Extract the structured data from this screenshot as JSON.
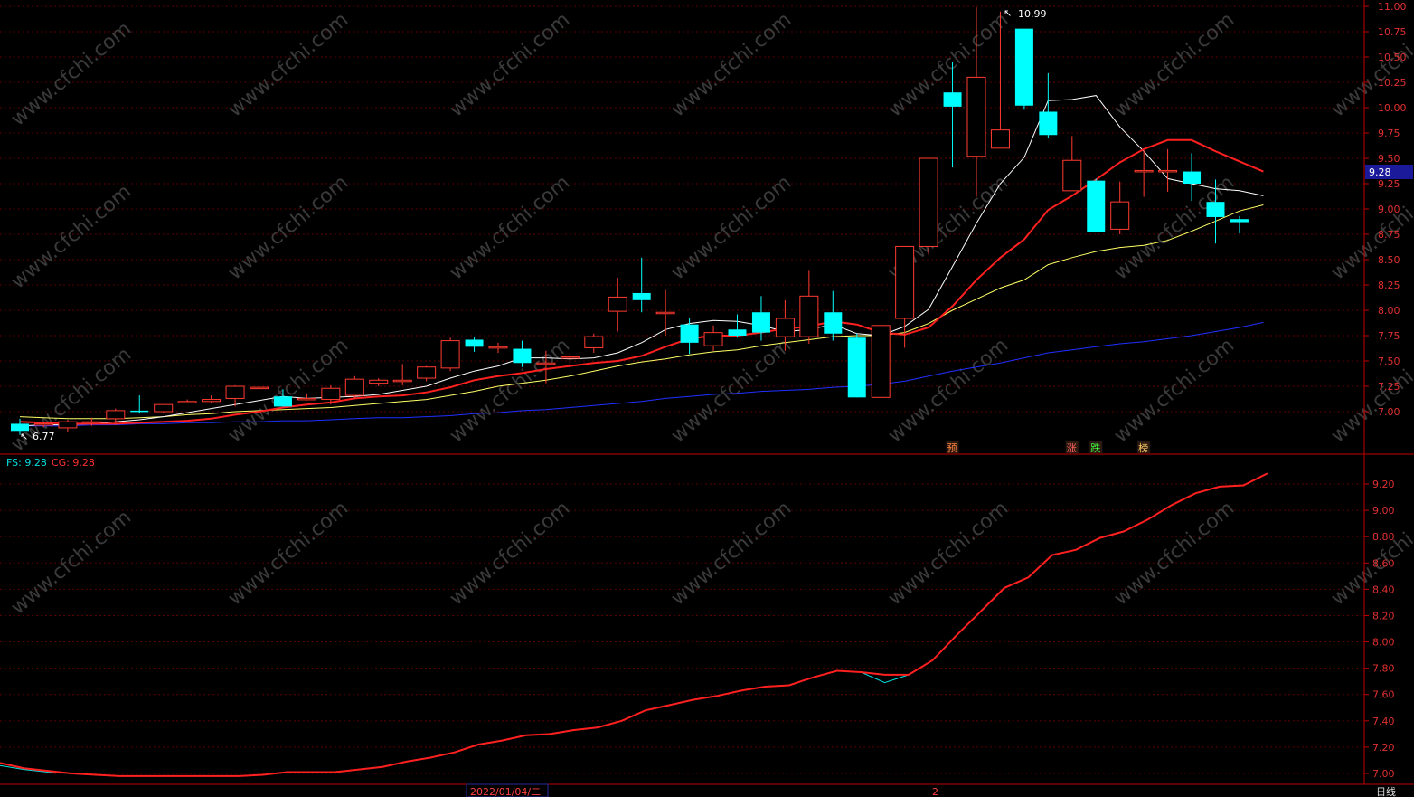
{
  "watermark": "www.cfchi.com",
  "date_label": "2022/01/04/二",
  "month_marker": "2",
  "period_label": "日线",
  "last_price_tag": "9.28",
  "colors": {
    "up": "#ff3b30",
    "down": "#00ffff",
    "grid": "#5a0000",
    "axis": "#c00000",
    "ma_fast": "#ffffff",
    "ma_mid": "#ff2020",
    "ma_slow": "#ffff66",
    "ma_long": "#2030ff",
    "fs_line": "#00e0e0",
    "cg_line": "#ff2020",
    "price_tag_bg": "#1a1a9a"
  },
  "indicator_legend": {
    "fs_label": "FS: 9.28",
    "cg_label": "CG: 9.28"
  },
  "annotations": {
    "high": "10.99",
    "low": "6.77"
  },
  "event_tags": [
    {
      "idx": 39,
      "text": "预",
      "color": "#ff8040"
    },
    {
      "idx": 44,
      "text": "涨",
      "color": "#ff6060"
    },
    {
      "idx": 45,
      "text": "跌",
      "color": "#40ff40"
    },
    {
      "idx": 47,
      "text": "榜",
      "color": "#ffcc66"
    }
  ],
  "chart_data": [
    {
      "type": "candlestick",
      "ylim": [
        6.5,
        11.0
      ],
      "yticks": [
        7.0,
        7.25,
        7.5,
        7.75,
        8.0,
        8.25,
        8.5,
        8.75,
        9.0,
        9.25,
        9.5,
        9.75,
        10.0,
        10.25,
        10.5,
        10.75,
        11.0
      ],
      "candles": [
        {
          "o": 6.88,
          "h": 6.93,
          "l": 6.77,
          "c": 6.81
        },
        {
          "o": 6.88,
          "h": 6.9,
          "l": 6.85,
          "c": 6.88
        },
        {
          "o": 6.84,
          "h": 6.92,
          "l": 6.8,
          "c": 6.9
        },
        {
          "o": 6.9,
          "h": 6.94,
          "l": 6.86,
          "c": 6.9
        },
        {
          "o": 6.93,
          "h": 7.03,
          "l": 6.87,
          "c": 7.01
        },
        {
          "o": 7.01,
          "h": 7.16,
          "l": 6.98,
          "c": 7.0
        },
        {
          "o": 7.0,
          "h": 7.07,
          "l": 6.99,
          "c": 7.07
        },
        {
          "o": 7.1,
          "h": 7.12,
          "l": 7.08,
          "c": 7.1
        },
        {
          "o": 7.1,
          "h": 7.16,
          "l": 7.08,
          "c": 7.12
        },
        {
          "o": 7.13,
          "h": 7.26,
          "l": 7.05,
          "c": 7.25
        },
        {
          "o": 7.23,
          "h": 7.27,
          "l": 7.21,
          "c": 7.24
        },
        {
          "o": 7.15,
          "h": 7.22,
          "l": 7.05,
          "c": 7.05
        },
        {
          "o": 7.13,
          "h": 7.18,
          "l": 7.11,
          "c": 7.13
        },
        {
          "o": 7.12,
          "h": 7.26,
          "l": 7.07,
          "c": 7.23
        },
        {
          "o": 7.16,
          "h": 7.35,
          "l": 7.12,
          "c": 7.32
        },
        {
          "o": 7.28,
          "h": 7.33,
          "l": 7.25,
          "c": 7.31
        },
        {
          "o": 7.31,
          "h": 7.47,
          "l": 7.26,
          "c": 7.31
        },
        {
          "o": 7.33,
          "h": 7.45,
          "l": 7.3,
          "c": 7.44
        },
        {
          "o": 7.43,
          "h": 7.73,
          "l": 7.4,
          "c": 7.7
        },
        {
          "o": 7.71,
          "h": 7.74,
          "l": 7.59,
          "c": 7.64
        },
        {
          "o": 7.64,
          "h": 7.68,
          "l": 7.58,
          "c": 7.64
        },
        {
          "o": 7.62,
          "h": 7.7,
          "l": 7.44,
          "c": 7.48
        },
        {
          "o": 7.48,
          "h": 7.6,
          "l": 7.28,
          "c": 7.48
        },
        {
          "o": 7.54,
          "h": 7.58,
          "l": 7.44,
          "c": 7.54
        },
        {
          "o": 7.63,
          "h": 7.77,
          "l": 7.58,
          "c": 7.74
        },
        {
          "o": 7.99,
          "h": 8.32,
          "l": 7.79,
          "c": 8.13
        },
        {
          "o": 8.17,
          "h": 8.52,
          "l": 7.98,
          "c": 8.1
        },
        {
          "o": 7.98,
          "h": 8.2,
          "l": 7.75,
          "c": 7.98
        },
        {
          "o": 7.86,
          "h": 7.92,
          "l": 7.57,
          "c": 7.68
        },
        {
          "o": 7.65,
          "h": 7.85,
          "l": 7.6,
          "c": 7.78
        },
        {
          "o": 7.81,
          "h": 7.96,
          "l": 7.73,
          "c": 7.75
        },
        {
          "o": 7.98,
          "h": 8.14,
          "l": 7.7,
          "c": 7.78
        },
        {
          "o": 7.74,
          "h": 8.1,
          "l": 7.6,
          "c": 7.92
        },
        {
          "o": 7.74,
          "h": 8.39,
          "l": 7.67,
          "c": 8.14
        },
        {
          "o": 7.98,
          "h": 8.19,
          "l": 7.7,
          "c": 7.77
        },
        {
          "o": 7.73,
          "h": 7.77,
          "l": 7.14,
          "c": 7.14
        },
        {
          "o": 7.14,
          "h": 7.85,
          "l": 7.14,
          "c": 7.85
        },
        {
          "o": 7.92,
          "h": 8.63,
          "l": 7.63,
          "c": 8.63
        },
        {
          "o": 8.63,
          "h": 9.5,
          "l": 8.55,
          "c": 9.5
        },
        {
          "o": 10.15,
          "h": 10.45,
          "l": 9.41,
          "c": 10.01
        },
        {
          "o": 9.52,
          "h": 10.99,
          "l": 9.12,
          "c": 10.3
        },
        {
          "o": 9.6,
          "h": 10.95,
          "l": 9.6,
          "c": 9.78
        },
        {
          "o": 10.78,
          "h": 10.78,
          "l": 9.98,
          "c": 10.02
        },
        {
          "o": 9.96,
          "h": 10.34,
          "l": 9.7,
          "c": 9.73
        },
        {
          "o": 9.18,
          "h": 9.72,
          "l": 9.18,
          "c": 9.48
        },
        {
          "o": 9.28,
          "h": 9.3,
          "l": 8.77,
          "c": 8.77
        },
        {
          "o": 8.8,
          "h": 9.27,
          "l": 8.75,
          "c": 9.07
        },
        {
          "o": 9.38,
          "h": 9.58,
          "l": 9.12,
          "c": 9.38
        },
        {
          "o": 9.38,
          "h": 9.59,
          "l": 9.17,
          "c": 9.38
        },
        {
          "o": 9.37,
          "h": 9.55,
          "l": 9.08,
          "c": 9.25
        },
        {
          "o": 9.07,
          "h": 9.29,
          "l": 8.66,
          "c": 8.92
        },
        {
          "o": 8.9,
          "h": 8.93,
          "l": 8.76,
          "c": 8.87
        }
      ],
      "ma_fast": [
        6.86,
        6.87,
        6.87,
        6.88,
        6.9,
        6.92,
        6.95,
        6.99,
        7.03,
        7.07,
        7.11,
        7.15,
        7.13,
        7.14,
        7.15,
        7.17,
        7.21,
        7.25,
        7.33,
        7.4,
        7.45,
        7.53,
        7.53,
        7.52,
        7.53,
        7.58,
        7.68,
        7.81,
        7.87,
        7.9,
        7.89,
        7.85,
        7.79,
        7.81,
        7.86,
        7.77,
        7.75,
        7.84,
        8.01,
        8.43,
        8.86,
        9.25,
        9.51,
        10.07,
        10.08,
        10.12,
        9.81,
        9.57,
        9.3,
        9.25,
        9.2,
        9.18,
        9.13
      ],
      "ma_mid": [
        6.9,
        6.89,
        6.88,
        6.88,
        6.88,
        6.89,
        6.9,
        6.91,
        6.93,
        6.97,
        7.0,
        7.04,
        7.07,
        7.09,
        7.13,
        7.15,
        7.16,
        7.19,
        7.24,
        7.31,
        7.35,
        7.38,
        7.42,
        7.45,
        7.48,
        7.5,
        7.55,
        7.64,
        7.72,
        7.75,
        7.75,
        7.78,
        7.82,
        7.84,
        7.89,
        7.86,
        7.78,
        7.76,
        7.83,
        8.04,
        8.3,
        8.52,
        8.7,
        8.99,
        9.13,
        9.29,
        9.46,
        9.59,
        9.68,
        9.68,
        9.57,
        9.47,
        9.37
      ],
      "ma_slow": [
        6.95,
        6.94,
        6.93,
        6.93,
        6.93,
        6.94,
        6.95,
        6.97,
        6.98,
        7.0,
        7.01,
        7.02,
        7.03,
        7.04,
        7.06,
        7.08,
        7.1,
        7.12,
        7.16,
        7.2,
        7.25,
        7.28,
        7.31,
        7.35,
        7.4,
        7.45,
        7.49,
        7.52,
        7.56,
        7.59,
        7.61,
        7.65,
        7.68,
        7.71,
        7.74,
        7.75,
        7.75,
        7.78,
        7.87,
        8.0,
        8.11,
        8.22,
        8.3,
        8.45,
        8.52,
        8.58,
        8.62,
        8.64,
        8.69,
        8.78,
        8.88,
        8.98,
        9.04
      ],
      "ma_long": [
        6.86,
        6.86,
        6.86,
        6.87,
        6.87,
        6.88,
        6.88,
        6.89,
        6.89,
        6.9,
        6.9,
        6.91,
        6.91,
        6.92,
        6.93,
        6.94,
        6.94,
        6.95,
        6.96,
        6.98,
        6.99,
        7.01,
        7.02,
        7.04,
        7.06,
        7.08,
        7.1,
        7.13,
        7.15,
        7.17,
        7.18,
        7.2,
        7.21,
        7.22,
        7.24,
        7.25,
        7.27,
        7.3,
        7.35,
        7.4,
        7.44,
        7.48,
        7.53,
        7.58,
        7.61,
        7.64,
        7.67,
        7.69,
        7.72,
        7.75,
        7.79,
        7.83,
        7.88
      ]
    },
    {
      "type": "line",
      "ylim": [
        6.95,
        9.38
      ],
      "yticks": [
        7.0,
        7.2,
        7.4,
        7.6,
        7.8,
        8.0,
        8.2,
        8.4,
        8.6,
        8.8,
        9.0,
        9.2
      ],
      "series": [
        {
          "name": "FS",
          "values": [
            7.06,
            7.03,
            7.01,
            7.0,
            6.99,
            6.98,
            6.98,
            6.98,
            6.98,
            6.98,
            6.98,
            6.99,
            7.01,
            7.01,
            7.01,
            7.03,
            7.05,
            7.09,
            7.12,
            7.16,
            7.22,
            7.25,
            7.29,
            7.3,
            7.33,
            7.35,
            7.4,
            7.48,
            7.52,
            7.56,
            7.59,
            7.63,
            7.66,
            7.67,
            7.73,
            7.78,
            7.77,
            7.69,
            7.75,
            7.86,
            8.05,
            8.23,
            8.41,
            8.49,
            8.66,
            8.7,
            8.79,
            8.84,
            8.93,
            9.04,
            9.13,
            9.18,
            9.19,
            9.28
          ]
        },
        {
          "name": "CG",
          "values": [
            7.08,
            7.04,
            7.02,
            7.0,
            6.99,
            6.98,
            6.98,
            6.98,
            6.98,
            6.98,
            6.98,
            6.99,
            7.01,
            7.01,
            7.01,
            7.03,
            7.05,
            7.09,
            7.12,
            7.16,
            7.22,
            7.25,
            7.29,
            7.3,
            7.33,
            7.35,
            7.4,
            7.48,
            7.52,
            7.56,
            7.59,
            7.63,
            7.66,
            7.67,
            7.73,
            7.78,
            7.77,
            7.75,
            7.75,
            7.86,
            8.05,
            8.23,
            8.41,
            8.49,
            8.66,
            8.7,
            8.79,
            8.84,
            8.93,
            9.04,
            9.13,
            9.18,
            9.19,
            9.28
          ]
        }
      ]
    }
  ]
}
